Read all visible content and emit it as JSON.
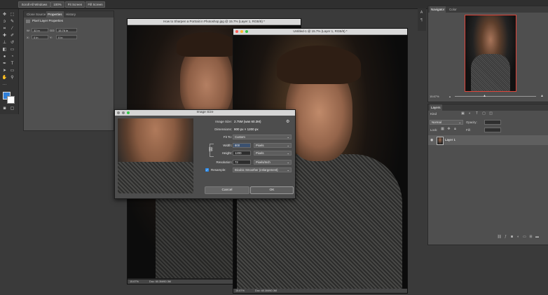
{
  "options_bar": {
    "buttons": [
      "Scroll All Windows",
      "100%",
      "Fit Screen",
      "Fill Screen"
    ]
  },
  "tools": [
    "move",
    "marquee",
    "lasso",
    "quick-select",
    "crop",
    "eyedropper",
    "healing",
    "brush",
    "stamp",
    "history-brush",
    "eraser",
    "gradient",
    "blur",
    "dodge",
    "pen",
    "type",
    "path-select",
    "shape",
    "hand",
    "zoom",
    "more"
  ],
  "properties_panel": {
    "tabs": [
      "Clone Source",
      "Properties",
      "History"
    ],
    "active_tab": "Properties",
    "header": "Pixel Layer Properties",
    "w_label": "W:",
    "w_value": "32 in",
    "go_label": "GO:",
    "go_value": "15.76 in",
    "x_label": "X:",
    "x_value": "0 in",
    "y_label": "Y:",
    "y_value": "0 in"
  },
  "doc1": {
    "title": "How to Sharpen a Portrait in Photoshop.jpg @ 15.7% (Layer 1, RGB/8) *",
    "zoom": "15.67%",
    "doc_info": "Doc: 60.3M/60.3M"
  },
  "doc2": {
    "title": "Untitled-1 @ 15.7% (Layer 1, RGB/8) *",
    "zoom": "15.67%",
    "doc_info": "Doc: 60.3M/60.3M"
  },
  "dialog": {
    "title": "Image Size",
    "image_size_label": "Image Size:",
    "image_size_value": "2.75M (was 60.3M)",
    "dimensions_label": "Dimensions:",
    "dimensions_value": "800 px  ×  1200 px",
    "fit_to_label": "Fit To:",
    "fit_to_value": "Custom",
    "width_label": "Width:",
    "width_value": "800",
    "width_unit": "Pixels",
    "height_label": "Height:",
    "height_value": "1200",
    "height_unit": "Pixels",
    "resolution_label": "Resolution:",
    "resolution_value": "72",
    "resolution_unit": "Pixels/Inch",
    "resample_label": "Resample:",
    "resample_value": "Bicubic Smoother (enlargement)",
    "cancel": "Cancel",
    "ok": "OK"
  },
  "navigator": {
    "tabs": [
      "Navigator",
      "Color"
    ],
    "active_tab": "Navigator",
    "zoom": "15.67%"
  },
  "layers_panel": {
    "title": "Layers",
    "kind_label": "Kind",
    "blend_mode": "Normal",
    "opacity_label": "Opacity:",
    "lock_label": "Lock:",
    "fill_label": "Fill:",
    "layers": [
      {
        "name": "Layer 1"
      }
    ]
  },
  "colors": {
    "accent": "#2d8ceb",
    "fg_swatch": "#2f7fd9",
    "bg_swatch": "#ffffff"
  }
}
